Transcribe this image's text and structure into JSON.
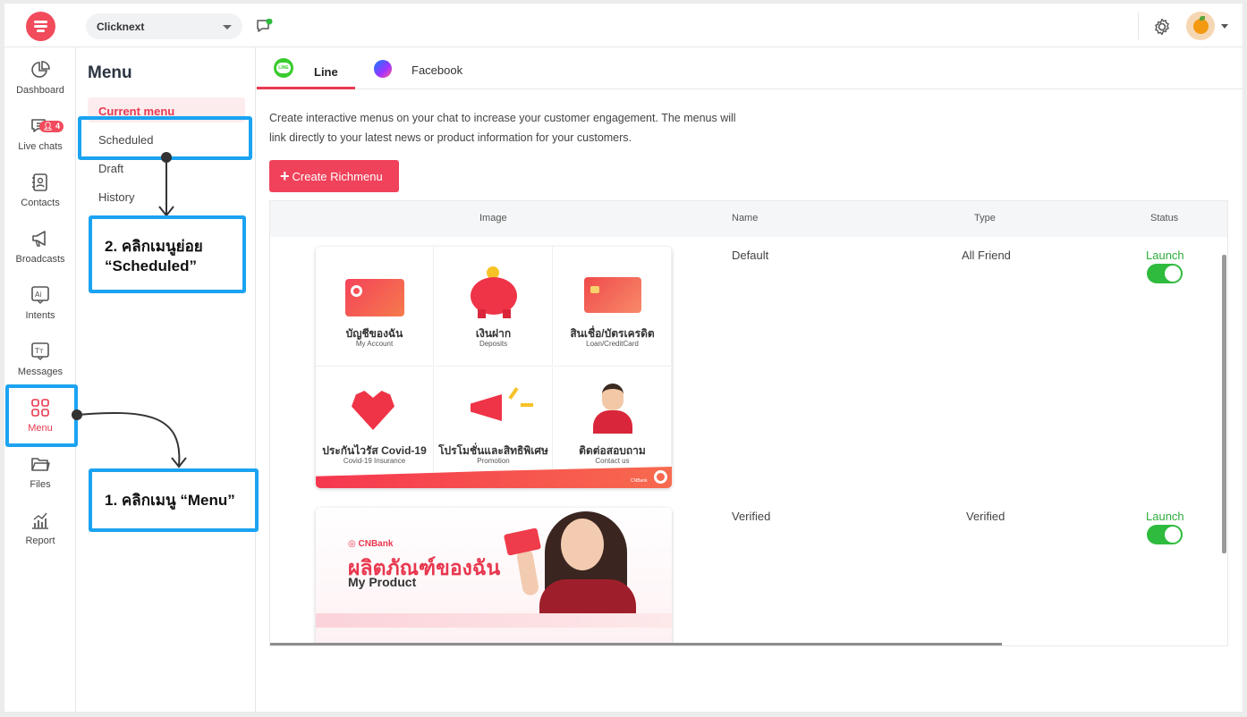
{
  "header": {
    "org_name": "Clicknext"
  },
  "sidebar": {
    "items": [
      {
        "label": "Dashboard"
      },
      {
        "label": "Live chats",
        "badge": "4"
      },
      {
        "label": "Contacts"
      },
      {
        "label": "Broadcasts"
      },
      {
        "label": "Intents"
      },
      {
        "label": "Messages"
      },
      {
        "label": "Menu",
        "active": true
      },
      {
        "label": "Files"
      },
      {
        "label": "Report"
      }
    ]
  },
  "menu_panel": {
    "title": "Menu",
    "items": [
      {
        "label": "Current menu",
        "active": true
      },
      {
        "label": "Scheduled"
      },
      {
        "label": "Draft"
      },
      {
        "label": "History"
      }
    ]
  },
  "tabs": [
    {
      "label": "Line",
      "icon_text": "LINE",
      "active": true
    },
    {
      "label": "Facebook"
    }
  ],
  "main": {
    "description": "Create interactive menus on your chat to increase your customer engagement. The menus will link directly to your latest news or product information for your customers.",
    "create_button": "Create Richmenu"
  },
  "table": {
    "headers": {
      "image": "Image",
      "name": "Name",
      "type": "Type",
      "status": "Status"
    },
    "rows": [
      {
        "name": "Default",
        "type": "All Friend",
        "status": "Launch",
        "enabled": true
      },
      {
        "name": "Verified",
        "type": "Verified",
        "status": "Launch",
        "enabled": true
      }
    ]
  },
  "richmenu_default": {
    "cells": [
      {
        "th": "บัญชีของฉัน",
        "en": "My Account"
      },
      {
        "th": "เงินฝาก",
        "en": "Deposits"
      },
      {
        "th": "สินเชื่อ/บัตรเครดิต",
        "en": "Loan/CreditCard"
      },
      {
        "th": "ประกันไวรัส Covid-19",
        "en": "Covid-19 Insurance"
      },
      {
        "th": "โปรโมชั่นและสิทธิพิเศษ",
        "en": "Promotion"
      },
      {
        "th": "ติดต่อสอบถาม",
        "en": "Contact us"
      }
    ],
    "footer_brand": "CNBank"
  },
  "richmenu_verified": {
    "brand": "CNBank",
    "title_th": "ผลิตภัณฑ์ของฉัน",
    "title_en": "My Product"
  },
  "annotations": {
    "step1": "1. คลิกเมนู “Menu”",
    "step2_line1": "2. คลิกเมนูย่อย",
    "step2_line2": "“Scheduled”"
  },
  "colors": {
    "accent": "#e8384f",
    "launch_green": "#2fbb3e",
    "annotation_blue": "#1ba3f2"
  }
}
